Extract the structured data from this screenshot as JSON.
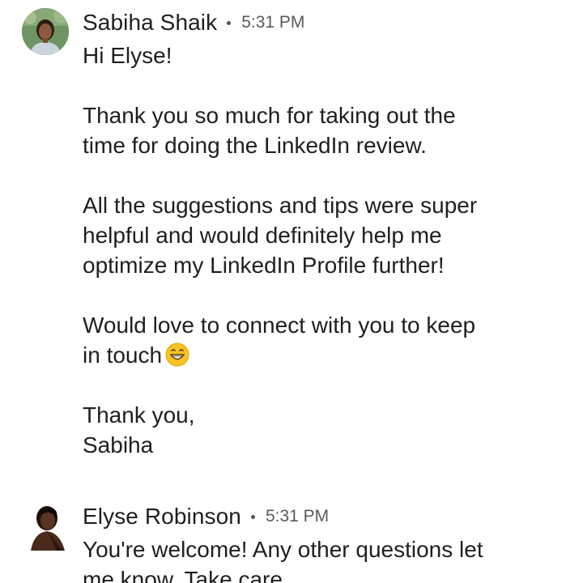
{
  "messages": [
    {
      "sender": "Sabiha Shaik",
      "time": "5:31 PM",
      "avatar_icon": "profile-photo-avatar",
      "lines": {
        "greeting": "Hi Elyse!",
        "p1_l1": "Thank you so much for taking out the",
        "p1_l2": "time for doing the LinkedIn review.",
        "p2_l1": "All the suggestions and tips were super",
        "p2_l2": "helpful and would definitely help me",
        "p2_l3": "optimize my LinkedIn Profile further!",
        "p3_l1": "Would love to connect with you to keep",
        "p3_l2": "in touch",
        "emoji": "grinning-face-emoji",
        "signoff_l1": "Thank you,",
        "signoff_l2": "Sabiha"
      }
    },
    {
      "sender": "Elyse Robinson",
      "time": "5:31 PM",
      "avatar_icon": "profile-photo-avatar",
      "lines": {
        "l1": "You're welcome! Any other questions let",
        "l2": "me know. Take care."
      }
    }
  ],
  "colors": {
    "text": "#1f1f1f",
    "timestamp": "#5a5a5a",
    "background": "#ffffff"
  }
}
